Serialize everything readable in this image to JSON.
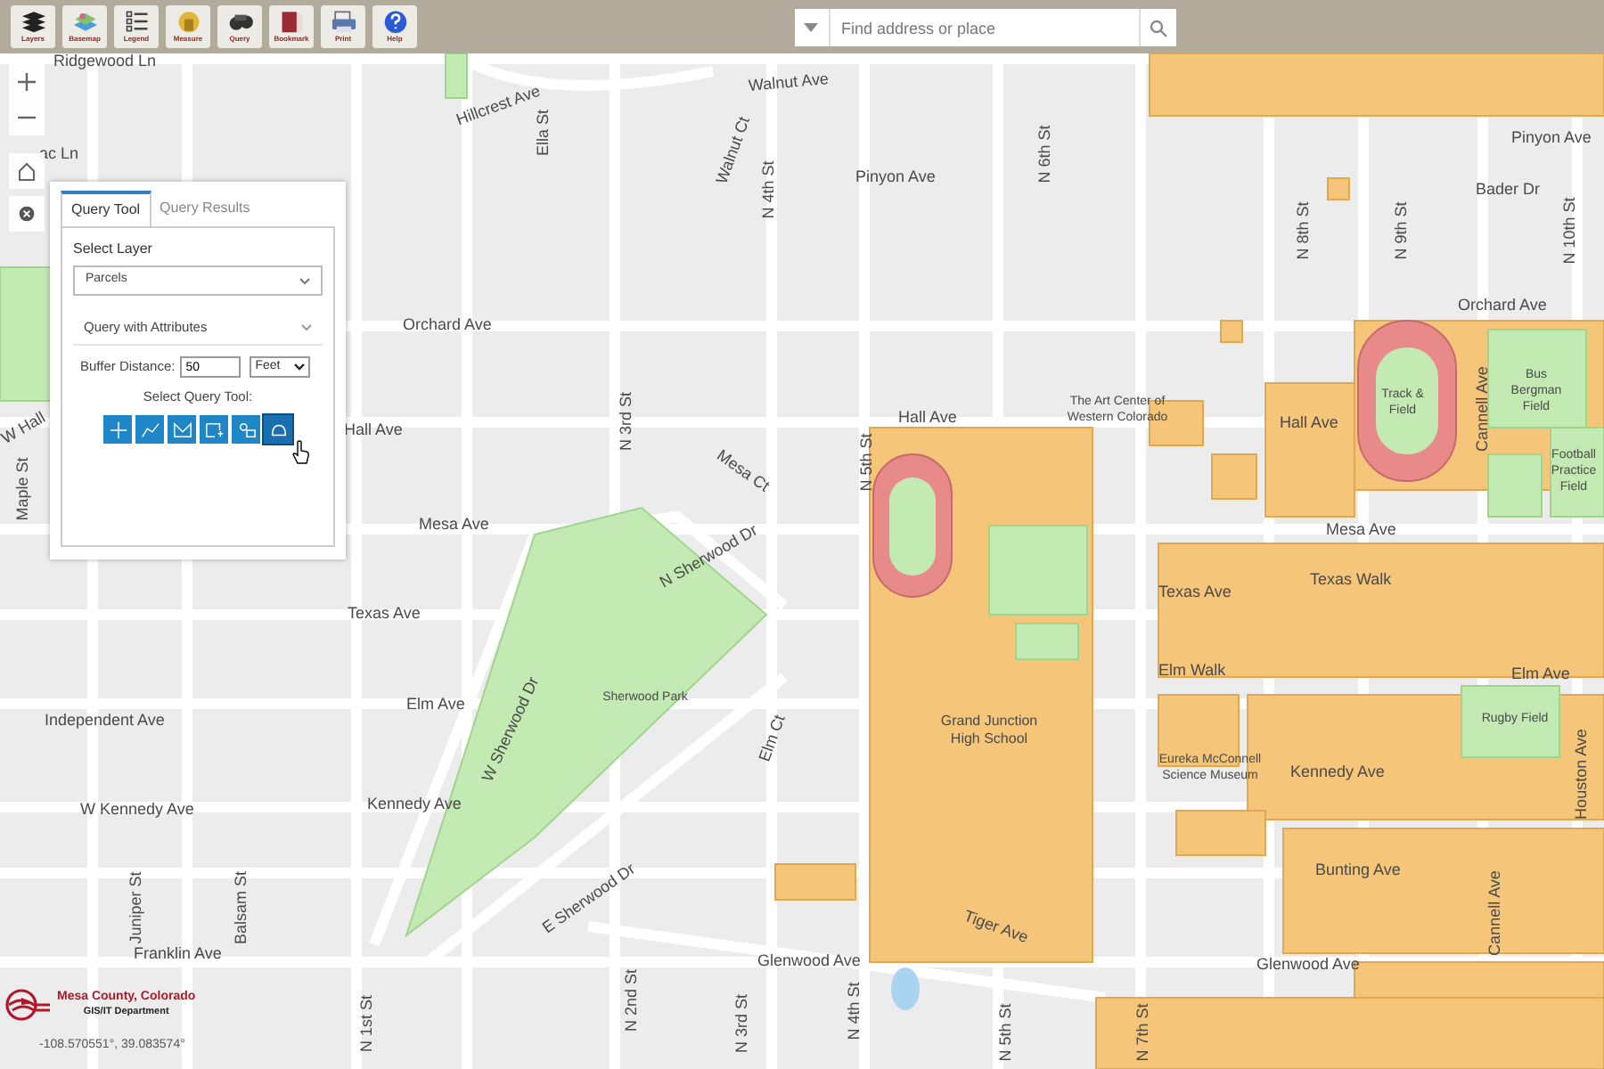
{
  "toolbar": {
    "buttons": [
      {
        "label": "Layers",
        "kind": "layers"
      },
      {
        "label": "Basemap",
        "kind": "basemap"
      },
      {
        "label": "Legend",
        "kind": "legend"
      },
      {
        "label": "Measure",
        "kind": "measure"
      },
      {
        "label": "Query",
        "kind": "query"
      },
      {
        "label": "Bookmark",
        "kind": "bookmark"
      },
      {
        "label": "Print",
        "kind": "print"
      },
      {
        "label": "Help",
        "kind": "help"
      }
    ]
  },
  "search": {
    "placeholder": "Find address or place"
  },
  "map_controls": [
    {
      "kind": "zoom_in"
    },
    {
      "kind": "zoom_out"
    },
    {
      "kind": "home"
    },
    {
      "kind": "close"
    }
  ],
  "query_panel": {
    "tabs": [
      {
        "label": "Query Tool",
        "selected": true
      },
      {
        "label": "Query Results",
        "selected": false
      }
    ],
    "select_layer_label": "Select Layer",
    "layer": "Parcels",
    "query_mode": "Query with Attributes",
    "buffer_label": "Buffer Distance:",
    "buffer_value": "50",
    "buffer_unit": "Feet",
    "tool_label": "Select Query Tool:",
    "tools": [
      {
        "kind": "point",
        "selected": false
      },
      {
        "kind": "polyline",
        "selected": false
      },
      {
        "kind": "freehand",
        "selected": false
      },
      {
        "kind": "rectangle",
        "selected": false
      },
      {
        "kind": "lasso",
        "selected": false
      },
      {
        "kind": "extent",
        "selected": true
      }
    ]
  },
  "map_labels": [
    {
      "text": "Ridgewood Ln"
    },
    {
      "text": "Hillcrest Ave"
    },
    {
      "text": "Walnut Ct"
    },
    {
      "text": "Walnut Ave"
    },
    {
      "text": "Ella St"
    },
    {
      "text": "ac Ln"
    },
    {
      "text": "N 4th St"
    },
    {
      "text": "N 6th St"
    },
    {
      "text": "Pinyon Ave"
    },
    {
      "text": "Pinyon Ave"
    },
    {
      "text": "Bader Dr"
    },
    {
      "text": "N 8th St"
    },
    {
      "text": "N 9th St"
    },
    {
      "text": "N 10th St"
    },
    {
      "text": "Orchard Ave"
    },
    {
      "text": "Orchard Ave"
    },
    {
      "text": "N 3rd St"
    },
    {
      "text": "W Hall"
    },
    {
      "text": "Hall Ave"
    },
    {
      "text": "Hall Ave"
    },
    {
      "text": "Hall Ave"
    },
    {
      "text": "Maple St"
    },
    {
      "text": "Mesa Ct"
    },
    {
      "text": "N 5th St"
    },
    {
      "text": "The Art Center of Western Colorado"
    },
    {
      "text": "Track & Field"
    },
    {
      "text": "Bus Bergman Field"
    },
    {
      "text": "Cannell Ave"
    },
    {
      "text": "Football Practice Field"
    },
    {
      "text": "Mesa Ave"
    },
    {
      "text": "Mesa Ave"
    },
    {
      "text": "Texas Ave"
    },
    {
      "text": "Texas Ave"
    },
    {
      "text": "Texas Walk"
    },
    {
      "text": "N Sherwood Dr"
    },
    {
      "text": "W Sherwood Dr"
    },
    {
      "text": "Sherwood Park"
    },
    {
      "text": "Elm Ave"
    },
    {
      "text": "Elm Ave"
    },
    {
      "text": "Elm Walk"
    },
    {
      "text": "Independent Ave"
    },
    {
      "text": "Grand Junction High School"
    },
    {
      "text": "Elm Ct"
    },
    {
      "text": "Rugby Field"
    },
    {
      "text": "Eureka McConnell Science Museum"
    },
    {
      "text": "Kennedy Ave"
    },
    {
      "text": "Kennedy Ave"
    },
    {
      "text": "W Kennedy Ave"
    },
    {
      "text": "Houston Ave"
    },
    {
      "text": "Bunting Ave"
    },
    {
      "text": "Franklin Ave"
    },
    {
      "text": "Glenwood Ave"
    },
    {
      "text": "Glenwood Ave"
    },
    {
      "text": "Tiger Ave"
    },
    {
      "text": "E Sherwood Dr"
    },
    {
      "text": "Juniper St"
    },
    {
      "text": "Balsam St"
    },
    {
      "text": "N 1st St"
    },
    {
      "text": "N 2nd St"
    },
    {
      "text": "N 3rd St"
    },
    {
      "text": "N 4th St"
    },
    {
      "text": "N 5th St"
    },
    {
      "text": "N 7th St"
    },
    {
      "text": "Cannell Ave"
    }
  ],
  "logo": {
    "title": "Mesa County, Colorado",
    "subtitle": "GIS/IT Department"
  },
  "coordinates": "-108.570551°, 39.083574°"
}
